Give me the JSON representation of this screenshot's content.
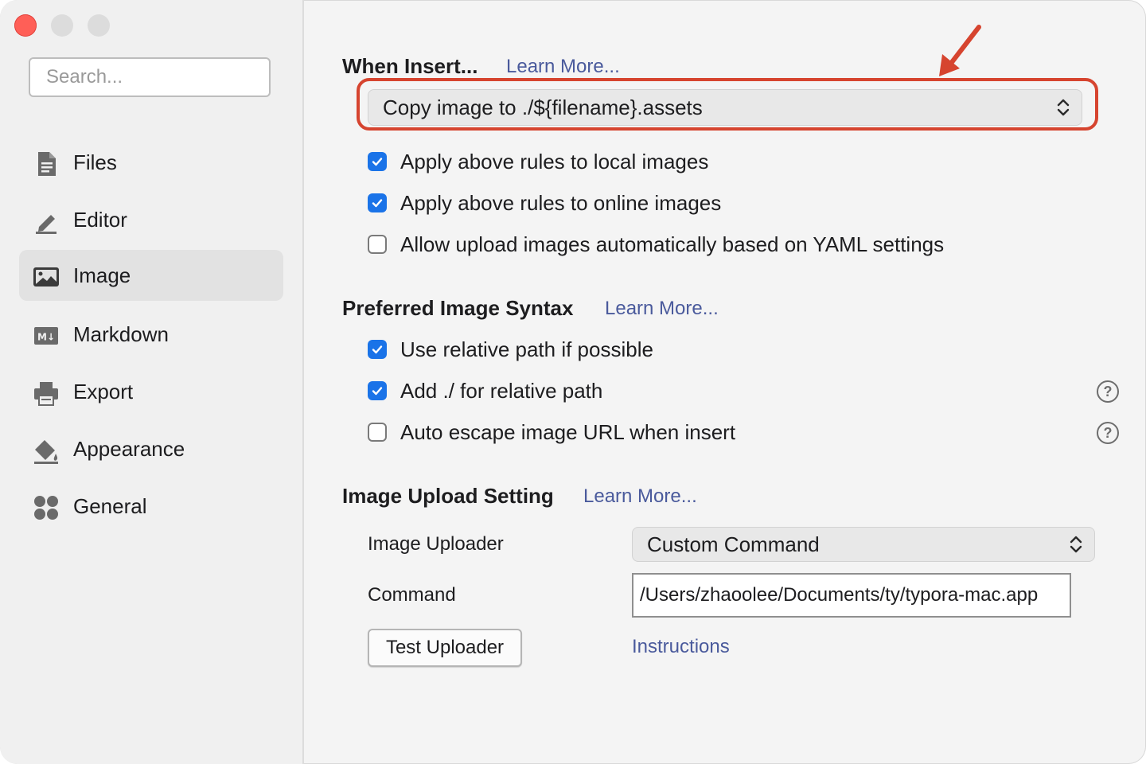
{
  "colors": {
    "accent": "#1a73e8",
    "link": "#4a5a9c",
    "annotation": "#d6442f",
    "close": "#ff5f57"
  },
  "sidebar": {
    "search_placeholder": "Search...",
    "items": [
      {
        "label": "Files",
        "icon": "file-icon",
        "active": false
      },
      {
        "label": "Editor",
        "icon": "pencil-icon",
        "active": false
      },
      {
        "label": "Image",
        "icon": "image-icon",
        "active": true
      },
      {
        "label": "Markdown",
        "icon": "markdown-icon",
        "active": false
      },
      {
        "label": "Export",
        "icon": "printer-icon",
        "active": false
      },
      {
        "label": "Appearance",
        "icon": "paint-bucket-icon",
        "active": false
      },
      {
        "label": "General",
        "icon": "grid-icon",
        "active": false
      }
    ]
  },
  "when_insert": {
    "title": "When Insert...",
    "learn_more": "Learn More...",
    "select_value": "Copy image to ./${filename}.assets",
    "options": [
      {
        "label": "Apply above rules to local images",
        "checked": true
      },
      {
        "label": "Apply above rules to online images",
        "checked": true
      },
      {
        "label": "Allow upload images automatically based on YAML settings",
        "checked": false
      }
    ]
  },
  "syntax": {
    "title": "Preferred Image Syntax",
    "learn_more": "Learn More...",
    "options": [
      {
        "label": "Use relative path if possible",
        "checked": true
      },
      {
        "label": "Add ./ for relative path",
        "checked": true
      },
      {
        "label": "Auto escape image URL when insert",
        "checked": false
      }
    ]
  },
  "upload": {
    "title": "Image Upload Setting",
    "learn_more": "Learn More...",
    "uploader_label": "Image Uploader",
    "uploader_value": "Custom Command",
    "command_label": "Command",
    "command_value": "/Users/zhaoolee/Documents/ty/typora-mac.app",
    "test_button": "Test Uploader",
    "instructions": "Instructions"
  }
}
